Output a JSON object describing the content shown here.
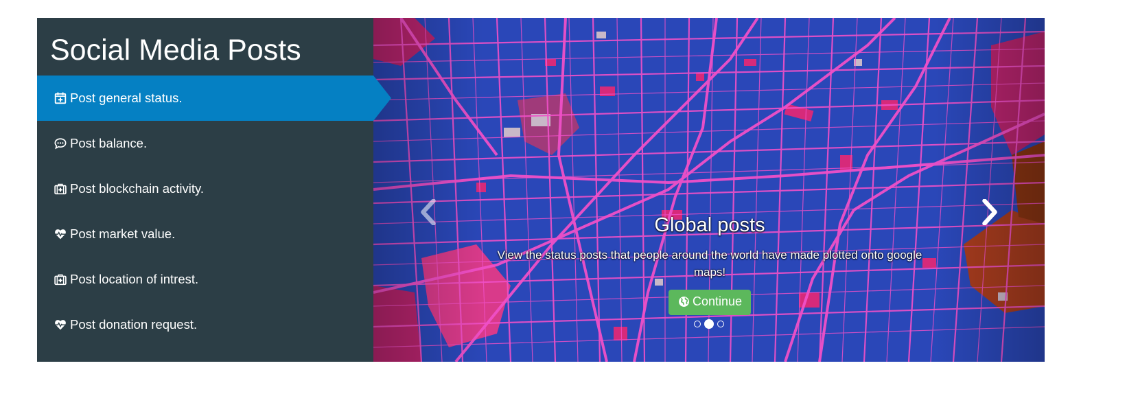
{
  "sidebar": {
    "title": "Social Media Posts",
    "items": [
      {
        "label": "Post general status.",
        "icon": "calendar-plus-icon",
        "active": true
      },
      {
        "label": "Post balance.",
        "icon": "comment-dots-icon",
        "active": false
      },
      {
        "label": "Post blockchain activity.",
        "icon": "medkit-icon",
        "active": false
      },
      {
        "label": "Post market value.",
        "icon": "heartbeat-icon",
        "active": false
      },
      {
        "label": "Post location of intrest.",
        "icon": "medkit-icon",
        "active": false
      },
      {
        "label": "Post donation request.",
        "icon": "heartbeat-icon",
        "active": false
      }
    ]
  },
  "carousel": {
    "slide": {
      "title": "Global posts",
      "text": "View the status posts that people around the world have made plotted onto google maps!",
      "button_label": "Continue",
      "button_icon": "globe-icon"
    },
    "slide_count": 3,
    "active_index": 1,
    "prev_icon": "chevron-left-icon",
    "next_icon": "chevron-right-icon"
  },
  "colors": {
    "sidebar_bg": "#2c3e46",
    "active_item_bg": "#0580c3",
    "map_bg": "#2a47b8",
    "map_roads": "#f050c8",
    "button_bg": "#5cb85c"
  }
}
